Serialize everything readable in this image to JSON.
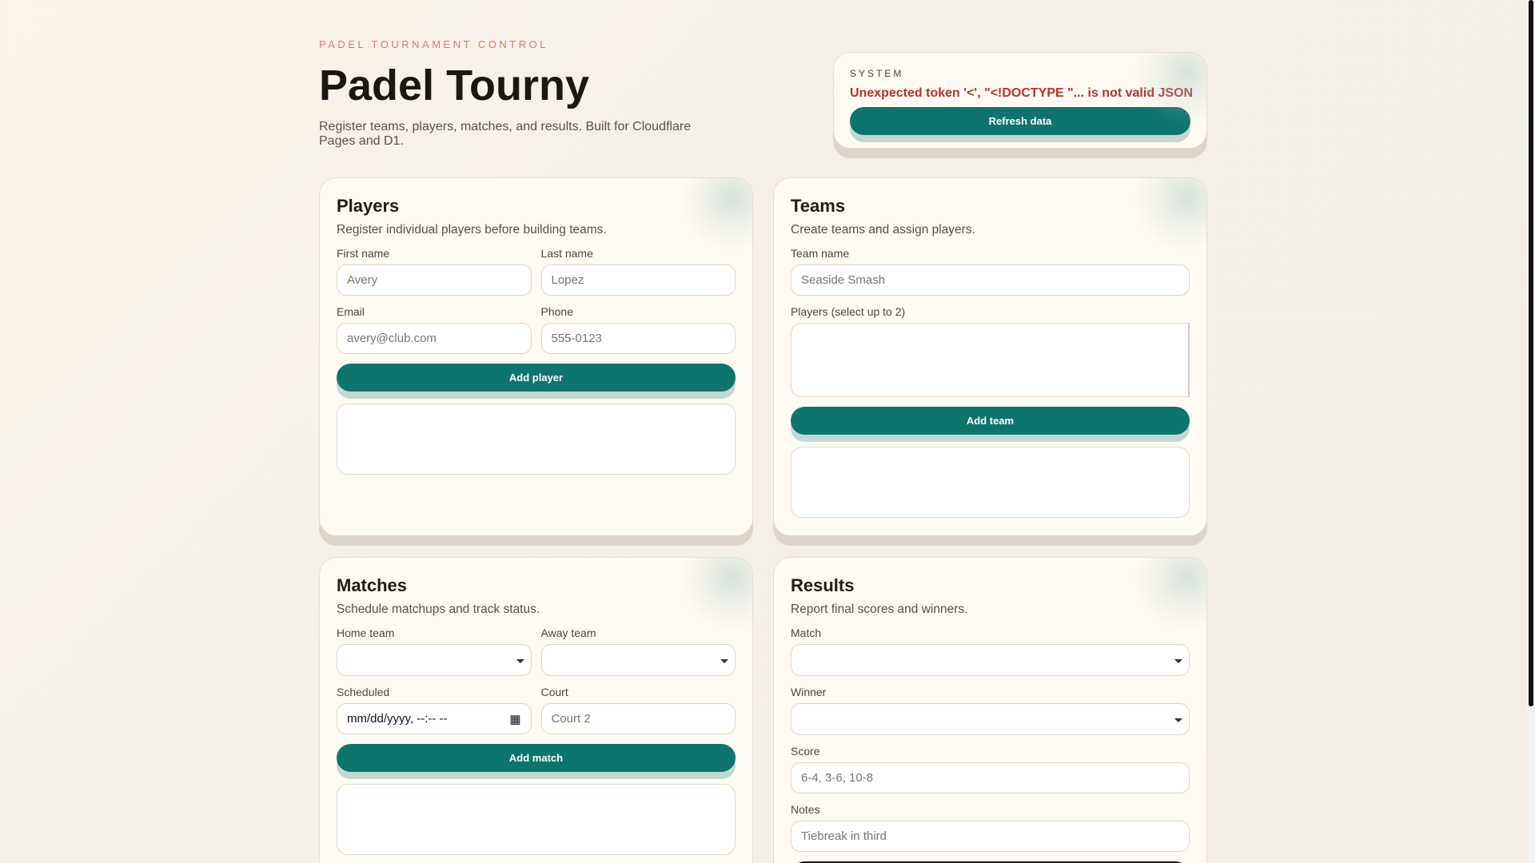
{
  "header": {
    "eyebrow": "PADEL TOURNAMENT CONTROL",
    "title": "Padel Tourny",
    "subtitle": "Register teams, players, matches, and results. Built for Cloudflare Pages and D1."
  },
  "system": {
    "label": "SYSTEM",
    "error": "Unexpected token '<', \"<!DOCTYPE \"... is not valid JSON",
    "refresh": "Refresh data"
  },
  "players": {
    "title": "Players",
    "desc": "Register individual players before building teams.",
    "first_label": "First name",
    "first_ph": "Avery",
    "last_label": "Last name",
    "last_ph": "Lopez",
    "email_label": "Email",
    "email_ph": "avery@club.com",
    "phone_label": "Phone",
    "phone_ph": "555-0123",
    "button": "Add player"
  },
  "teams": {
    "title": "Teams",
    "desc": "Create teams and assign players.",
    "name_label": "Team name",
    "name_ph": "Seaside Smash",
    "players_label": "Players (select up to 2)",
    "button": "Add team"
  },
  "matches": {
    "title": "Matches",
    "desc": "Schedule matchups and track status.",
    "home_label": "Home team",
    "away_label": "Away team",
    "scheduled_label": "Scheduled",
    "scheduled_value": "mm/dd/yyyy, --:-- --",
    "court_label": "Court",
    "court_ph": "Court 2",
    "button": "Add match"
  },
  "results": {
    "title": "Results",
    "desc": "Report final scores and winners.",
    "match_label": "Match",
    "winner_label": "Winner",
    "score_label": "Score",
    "score_ph": "6-4, 3-6, 10-8",
    "notes_label": "Notes",
    "notes_ph": "Tiebreak in third"
  }
}
